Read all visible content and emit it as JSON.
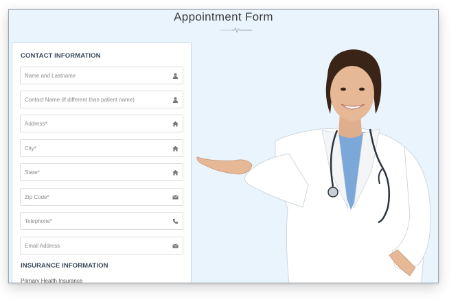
{
  "page": {
    "title": "Appointment Form"
  },
  "contact": {
    "heading": "CONTACT INFORMATION",
    "fields": [
      {
        "placeholder": "Name and Lastname",
        "icon": "user-icon"
      },
      {
        "placeholder": "Contact Name (if different than patient name)",
        "icon": "user-icon"
      },
      {
        "placeholder": "Address*",
        "icon": "home-icon"
      },
      {
        "placeholder": "City*",
        "icon": "home-icon"
      },
      {
        "placeholder": "State*",
        "icon": "home-icon"
      },
      {
        "placeholder": "Zip Code*",
        "icon": "envelope-icon"
      },
      {
        "placeholder": "Telephone*",
        "icon": "phone-icon"
      },
      {
        "placeholder": "Email Address",
        "icon": "envelope-icon"
      }
    ]
  },
  "insurance": {
    "heading": "INSURANCE INFORMATION",
    "primary_label": "Primary Health Insurance"
  },
  "colors": {
    "background": "#eaf4fc",
    "panel": "#ffffff",
    "heading": "#3a4a5a",
    "coat": "#ffffff",
    "scrubs": "#7ba7d9"
  }
}
